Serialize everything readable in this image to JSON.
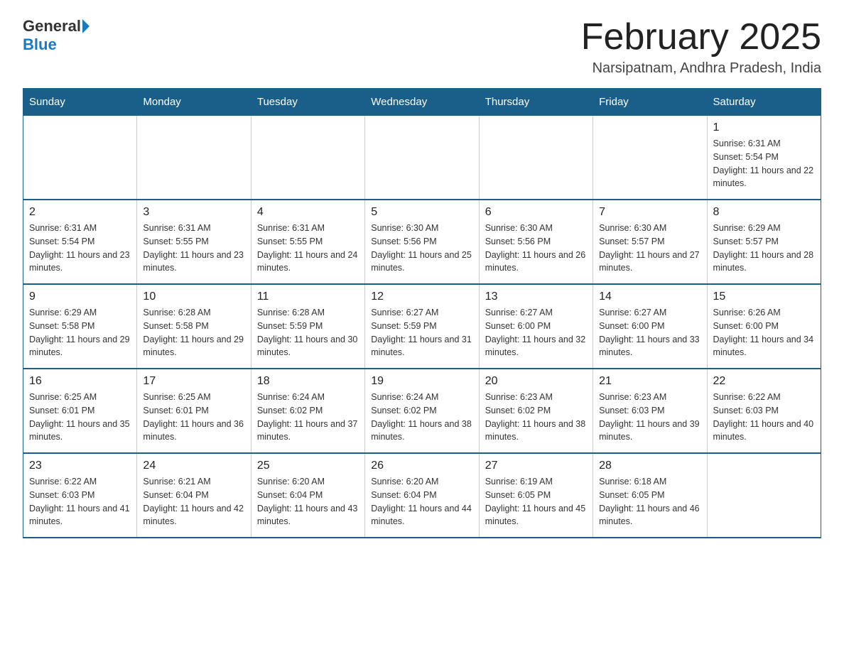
{
  "header": {
    "logo_general": "General",
    "logo_blue": "Blue",
    "month_title": "February 2025",
    "subtitle": "Narsipatnam, Andhra Pradesh, India"
  },
  "days_of_week": [
    "Sunday",
    "Monday",
    "Tuesday",
    "Wednesday",
    "Thursday",
    "Friday",
    "Saturday"
  ],
  "weeks": [
    [
      {
        "day": "",
        "info": ""
      },
      {
        "day": "",
        "info": ""
      },
      {
        "day": "",
        "info": ""
      },
      {
        "day": "",
        "info": ""
      },
      {
        "day": "",
        "info": ""
      },
      {
        "day": "",
        "info": ""
      },
      {
        "day": "1",
        "info": "Sunrise: 6:31 AM\nSunset: 5:54 PM\nDaylight: 11 hours and 22 minutes."
      }
    ],
    [
      {
        "day": "2",
        "info": "Sunrise: 6:31 AM\nSunset: 5:54 PM\nDaylight: 11 hours and 23 minutes."
      },
      {
        "day": "3",
        "info": "Sunrise: 6:31 AM\nSunset: 5:55 PM\nDaylight: 11 hours and 23 minutes."
      },
      {
        "day": "4",
        "info": "Sunrise: 6:31 AM\nSunset: 5:55 PM\nDaylight: 11 hours and 24 minutes."
      },
      {
        "day": "5",
        "info": "Sunrise: 6:30 AM\nSunset: 5:56 PM\nDaylight: 11 hours and 25 minutes."
      },
      {
        "day": "6",
        "info": "Sunrise: 6:30 AM\nSunset: 5:56 PM\nDaylight: 11 hours and 26 minutes."
      },
      {
        "day": "7",
        "info": "Sunrise: 6:30 AM\nSunset: 5:57 PM\nDaylight: 11 hours and 27 minutes."
      },
      {
        "day": "8",
        "info": "Sunrise: 6:29 AM\nSunset: 5:57 PM\nDaylight: 11 hours and 28 minutes."
      }
    ],
    [
      {
        "day": "9",
        "info": "Sunrise: 6:29 AM\nSunset: 5:58 PM\nDaylight: 11 hours and 29 minutes."
      },
      {
        "day": "10",
        "info": "Sunrise: 6:28 AM\nSunset: 5:58 PM\nDaylight: 11 hours and 29 minutes."
      },
      {
        "day": "11",
        "info": "Sunrise: 6:28 AM\nSunset: 5:59 PM\nDaylight: 11 hours and 30 minutes."
      },
      {
        "day": "12",
        "info": "Sunrise: 6:27 AM\nSunset: 5:59 PM\nDaylight: 11 hours and 31 minutes."
      },
      {
        "day": "13",
        "info": "Sunrise: 6:27 AM\nSunset: 6:00 PM\nDaylight: 11 hours and 32 minutes."
      },
      {
        "day": "14",
        "info": "Sunrise: 6:27 AM\nSunset: 6:00 PM\nDaylight: 11 hours and 33 minutes."
      },
      {
        "day": "15",
        "info": "Sunrise: 6:26 AM\nSunset: 6:00 PM\nDaylight: 11 hours and 34 minutes."
      }
    ],
    [
      {
        "day": "16",
        "info": "Sunrise: 6:25 AM\nSunset: 6:01 PM\nDaylight: 11 hours and 35 minutes."
      },
      {
        "day": "17",
        "info": "Sunrise: 6:25 AM\nSunset: 6:01 PM\nDaylight: 11 hours and 36 minutes."
      },
      {
        "day": "18",
        "info": "Sunrise: 6:24 AM\nSunset: 6:02 PM\nDaylight: 11 hours and 37 minutes."
      },
      {
        "day": "19",
        "info": "Sunrise: 6:24 AM\nSunset: 6:02 PM\nDaylight: 11 hours and 38 minutes."
      },
      {
        "day": "20",
        "info": "Sunrise: 6:23 AM\nSunset: 6:02 PM\nDaylight: 11 hours and 38 minutes."
      },
      {
        "day": "21",
        "info": "Sunrise: 6:23 AM\nSunset: 6:03 PM\nDaylight: 11 hours and 39 minutes."
      },
      {
        "day": "22",
        "info": "Sunrise: 6:22 AM\nSunset: 6:03 PM\nDaylight: 11 hours and 40 minutes."
      }
    ],
    [
      {
        "day": "23",
        "info": "Sunrise: 6:22 AM\nSunset: 6:03 PM\nDaylight: 11 hours and 41 minutes."
      },
      {
        "day": "24",
        "info": "Sunrise: 6:21 AM\nSunset: 6:04 PM\nDaylight: 11 hours and 42 minutes."
      },
      {
        "day": "25",
        "info": "Sunrise: 6:20 AM\nSunset: 6:04 PM\nDaylight: 11 hours and 43 minutes."
      },
      {
        "day": "26",
        "info": "Sunrise: 6:20 AM\nSunset: 6:04 PM\nDaylight: 11 hours and 44 minutes."
      },
      {
        "day": "27",
        "info": "Sunrise: 6:19 AM\nSunset: 6:05 PM\nDaylight: 11 hours and 45 minutes."
      },
      {
        "day": "28",
        "info": "Sunrise: 6:18 AM\nSunset: 6:05 PM\nDaylight: 11 hours and 46 minutes."
      },
      {
        "day": "",
        "info": ""
      }
    ]
  ]
}
